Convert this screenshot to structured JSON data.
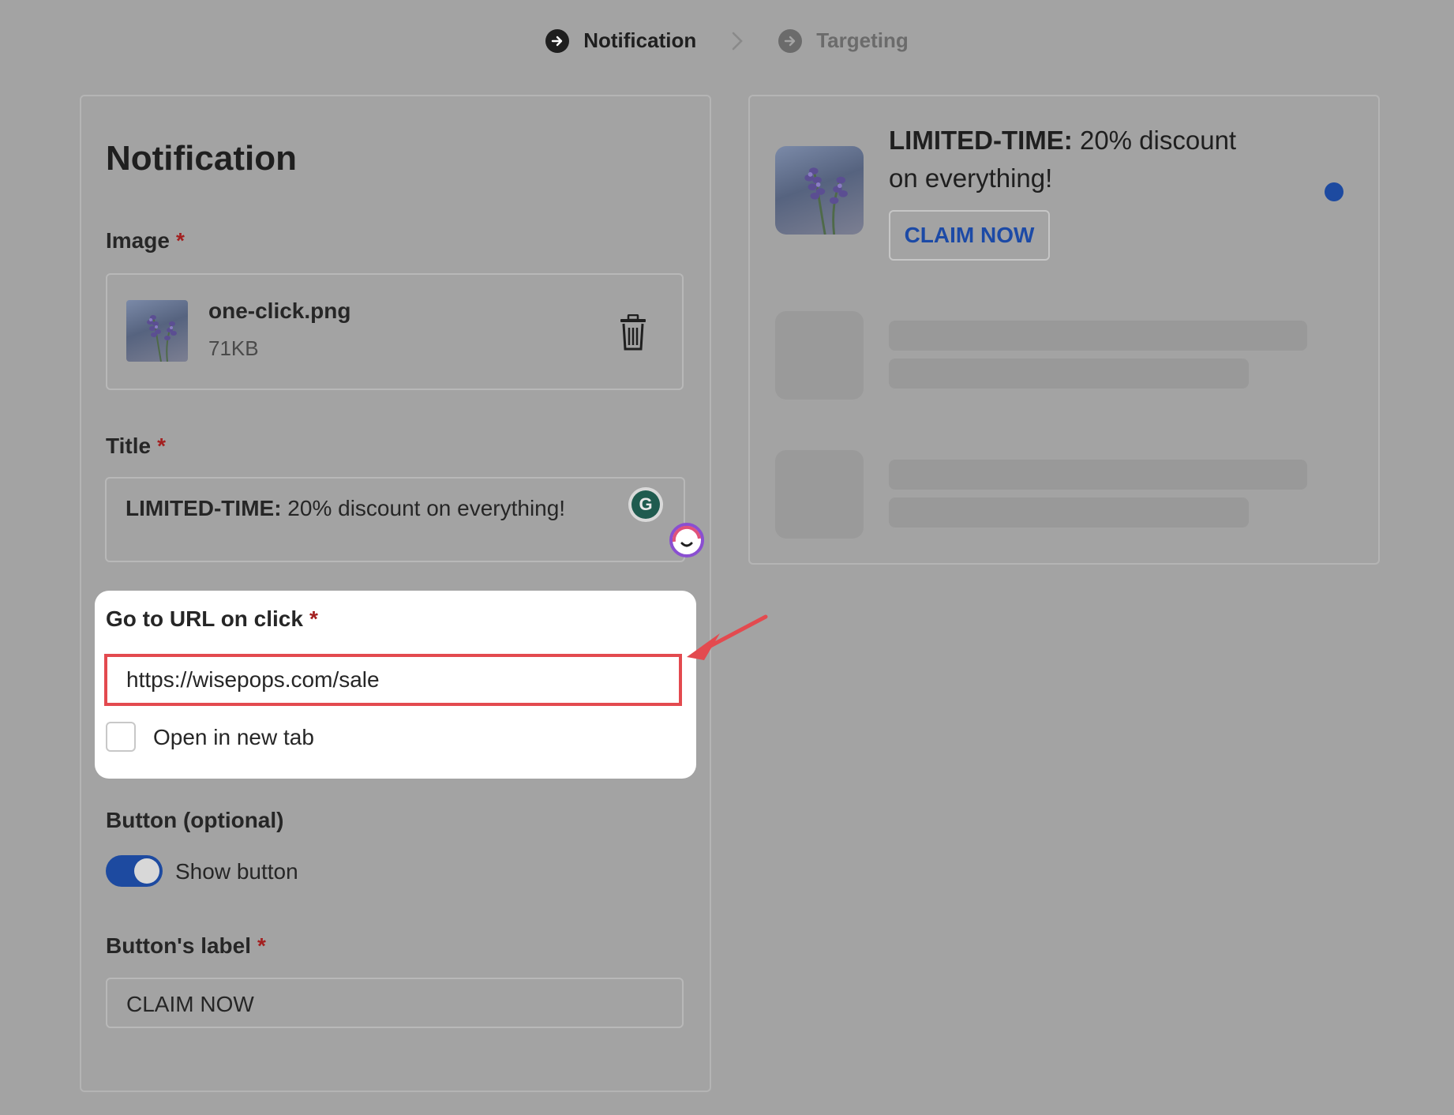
{
  "stepper": {
    "steps": [
      {
        "label": "Notification",
        "state": "active"
      },
      {
        "label": "Targeting",
        "state": "inactive"
      }
    ]
  },
  "form": {
    "title": "Notification",
    "required_marker": "*",
    "image": {
      "label": "Image",
      "file_name": "one-click.png",
      "file_size": "71KB"
    },
    "title_field": {
      "label": "Title",
      "bold_part": "LIMITED-TIME:",
      "rest": " 20% discount on everything!"
    },
    "url_field": {
      "label": "Go to URL on click",
      "value": "https://wisepops.com/sale",
      "checkbox_label": "Open in new tab",
      "checkbox_checked": false
    },
    "button_section": {
      "label": "Button (optional)",
      "toggle_label": "Show button",
      "toggle_on": true
    },
    "button_label_field": {
      "label": "Button's label",
      "value": "CLAIM NOW"
    }
  },
  "preview": {
    "title_bold": "LIMITED-TIME:",
    "title_rest": " 20% discount on everything!",
    "button_label": "CLAIM NOW"
  },
  "colors": {
    "overlay_bg": "#a3a3a3",
    "accent_blue": "#1d4aa0",
    "highlight_red": "#e34a4f",
    "required_red": "#a31f1f"
  },
  "icons": [
    "arrow-right-circle-icon",
    "chevron-right-icon",
    "trash-icon",
    "grammarly-icon",
    "assistant-face-icon",
    "red-pointer-arrow-icon"
  ]
}
